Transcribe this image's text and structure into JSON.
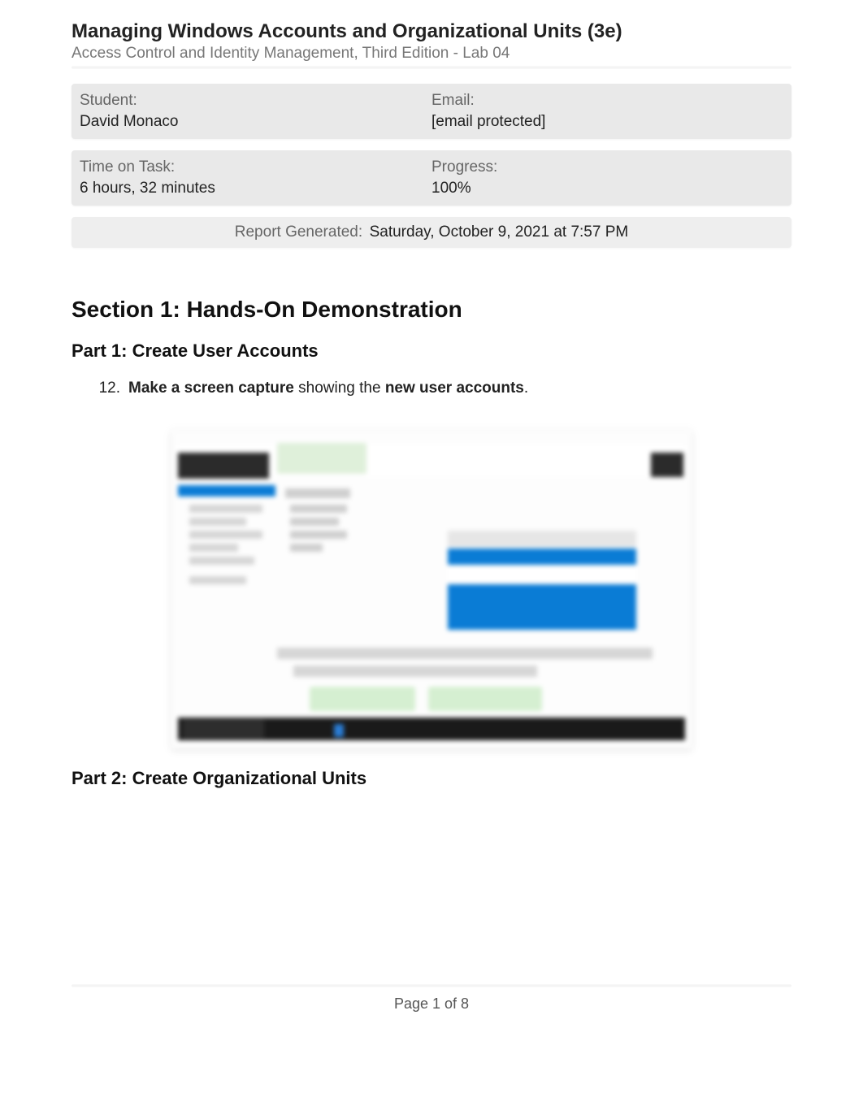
{
  "header": {
    "title": "Managing Windows Accounts and Organizational Units (3e)",
    "subtitle": "Access Control and Identity Management, Third Edition - Lab 04"
  },
  "info": {
    "student_label": "Student:",
    "student_value": "David Monaco",
    "email_label": "Email:",
    "email_value": "[email protected]",
    "time_label": "Time on Task:",
    "time_value": "6 hours, 32 minutes",
    "progress_label": "Progress:",
    "progress_value": "100%"
  },
  "report": {
    "label": "Report Generated:",
    "value": "Saturday, October 9, 2021 at 7:57 PM"
  },
  "section1": {
    "heading": "Section 1: Hands-On Demonstration",
    "part1_heading": "Part 1: Create User Accounts",
    "item_number": "12.",
    "item_bold1": "Make a screen capture",
    "item_mid": " showing the ",
    "item_bold2": "new user accounts",
    "item_end": ".",
    "part2_heading": "Part 2: Create Organizational Units"
  },
  "footer": {
    "page_text": "Page 1 of 8"
  }
}
